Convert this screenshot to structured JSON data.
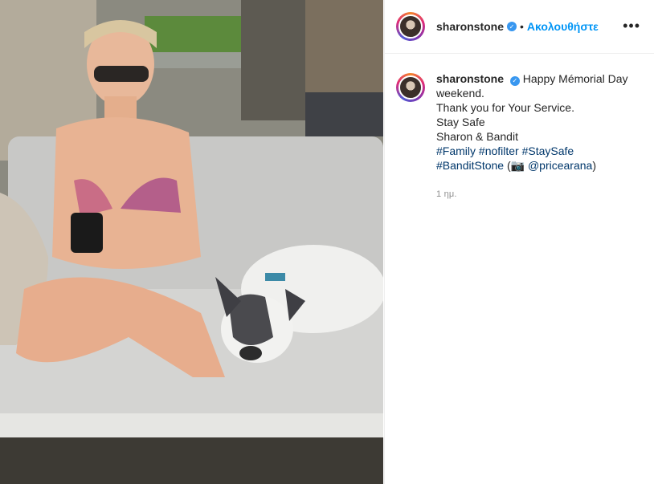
{
  "post": {
    "username": "sharonstone",
    "follow_label": "Ακολουθήστε",
    "more_icon": "more-horizontal-icon",
    "verified_icon": "verified-badge-icon",
    "caption": {
      "first_line": "Happy Mémorial Day",
      "lines": [
        "weekend.",
        "Thank you for Your Service.",
        "Stay Safe",
        "Sharon & Bandit"
      ],
      "hashtags_line1": [
        "#Family",
        "#nofilter",
        "#StaySafe"
      ],
      "hashtag_line2": "#BanditStone",
      "camera_icon": "camera-icon",
      "photo_credit": "@pricearana"
    },
    "timestamp": "1 ημ."
  }
}
